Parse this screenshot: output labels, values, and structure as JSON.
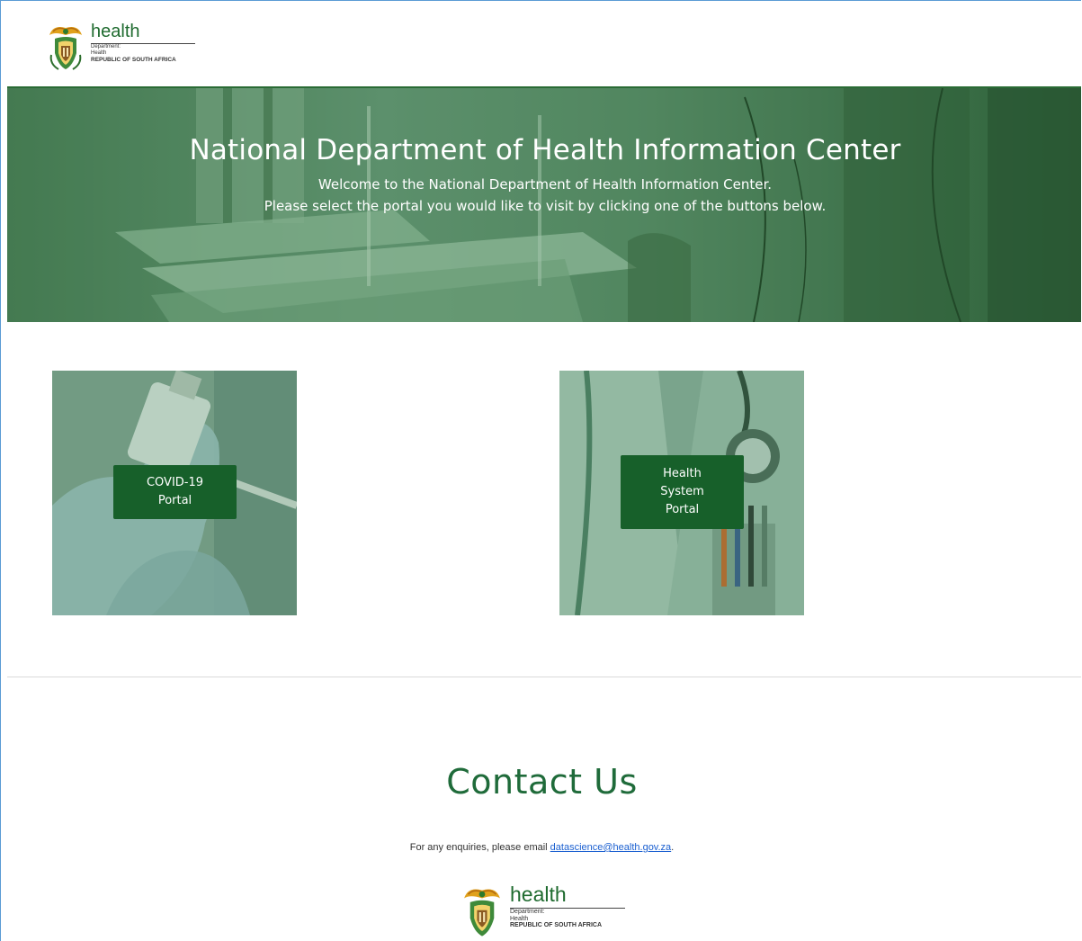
{
  "logo": {
    "word": "health",
    "line1": "Department:",
    "line2": "Health",
    "line3": "REPUBLIC OF SOUTH AFRICA"
  },
  "hero": {
    "title": "National Department of Health Information Center",
    "subtitle_line1": "Welcome to the National Department of Health Information Center.",
    "subtitle_line2": "Please select the portal you would like to visit by clicking one of the buttons below."
  },
  "portals": [
    {
      "line1": "COVID-19",
      "line2": "Portal"
    },
    {
      "line1": "Health",
      "line2": "System",
      "line3": "Portal"
    }
  ],
  "contact": {
    "title": "Contact Us",
    "text_prefix": "For any enquiries, please email ",
    "email": "datascience@health.gov.za",
    "text_suffix": "."
  },
  "colors": {
    "brand_green": "#17602a",
    "heading_green": "#1f6b3a",
    "link_blue": "#1a5fd0"
  }
}
